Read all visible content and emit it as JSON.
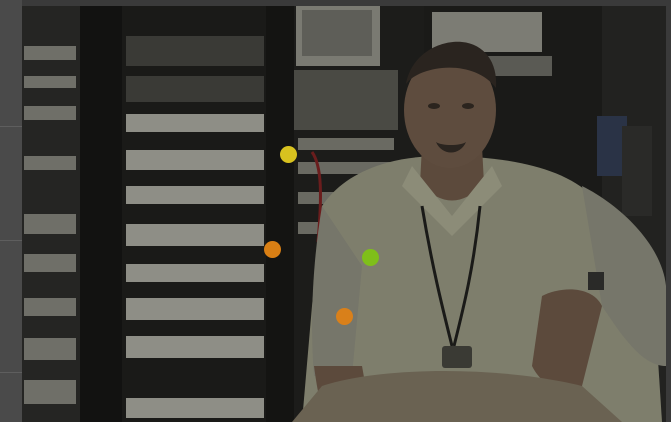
{
  "photo": {
    "alt": "",
    "subject": "server-room-technician-photo"
  },
  "hotspots": [
    {
      "name": "hotspot-yellow",
      "color": "#d8c21f"
    },
    {
      "name": "hotspot-orange-upper",
      "color": "#d97f14"
    },
    {
      "name": "hotspot-green",
      "color": "#7fbf1a"
    },
    {
      "name": "hotspot-orange-lower",
      "color": "#d9801a"
    }
  ],
  "colors": {
    "rack_dark": "#1c1c1a",
    "rack_panel": "#8e8e86",
    "shirt": "#8a8a78",
    "skin": "#5c4a3c",
    "background_overlay": "#2b2b2b"
  }
}
